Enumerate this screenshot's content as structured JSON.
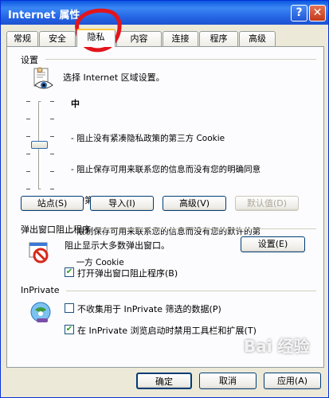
{
  "window": {
    "title": "Internet 属性",
    "help_glyph": "?",
    "close_glyph": "✕"
  },
  "tabs": [
    "常规",
    "安全",
    "隐私",
    "内容",
    "连接",
    "程序",
    "高级"
  ],
  "active_tab": "隐私",
  "settings": {
    "group_label": "设置",
    "zone_prompt": "选择 Internet 区域设置。",
    "level": "中",
    "level_fraction": 0.45,
    "descriptions": [
      "- 阻止没有紧凑隐私政策的第三方 Cookie",
      "- 阻止保存可用来联系您的信息而没有您的明确同意",
      "  的第三方 Cookie",
      "- 限制保存可用来联系您的信息而没有您的默许的第",
      "  一方 Cookie"
    ],
    "buttons": {
      "sites": "站点(S)",
      "import": "导入(I)",
      "advanced": "高级(V)",
      "default": "默认值(D)"
    }
  },
  "popup": {
    "group_label": "弹出窗口阻止程序",
    "description": "阻止显示大多数弹出窗口。",
    "settings_button": "设置(E)",
    "checkbox_label": "打开弹出窗口阻止程序(B)",
    "checkbox_checked": true
  },
  "inprivate": {
    "group_label": "InPrivate",
    "checkbox1_label": "不收集用于 InPrivate 筛选的数据(P)",
    "checkbox1_checked": false,
    "checkbox2_label": "在 InPrivate 浏览启动时禁用工具栏和扩展(T)",
    "checkbox2_checked": true
  },
  "footer": {
    "ok": "确定",
    "cancel": "取消",
    "apply": "应用(A)"
  },
  "watermark": "Bai 经验",
  "check_glyph": "✔"
}
